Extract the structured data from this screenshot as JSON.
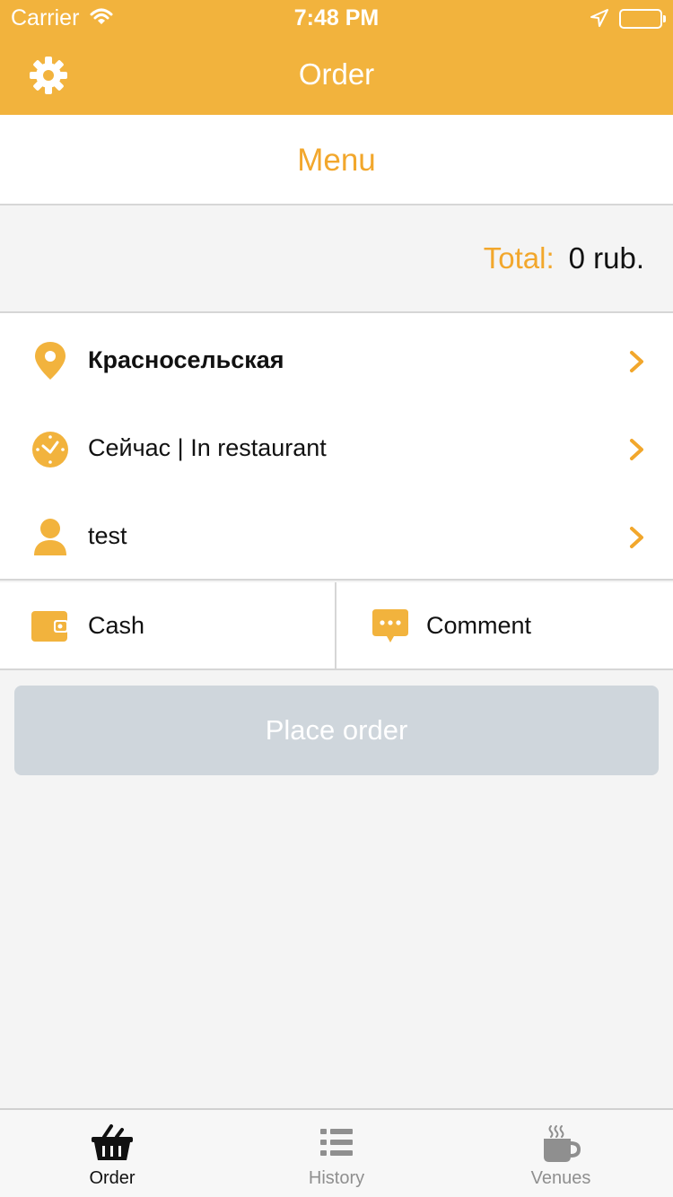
{
  "status_bar": {
    "carrier": "Carrier",
    "time": "7:48 PM",
    "icons": [
      "wifi-icon",
      "location-arrow-icon",
      "battery-icon"
    ]
  },
  "nav": {
    "title": "Order",
    "left_icon": "gear-icon"
  },
  "menu": {
    "label": "Menu"
  },
  "total": {
    "label": "Total:",
    "value": "0 rub."
  },
  "details": [
    {
      "icon": "location-pin-icon",
      "text": "Красносельская",
      "bold": true
    },
    {
      "icon": "clock-icon",
      "text": "Сейчас | In restaurant",
      "bold": false
    },
    {
      "icon": "user-icon",
      "text": "test",
      "bold": false
    }
  ],
  "payment": {
    "method_label": "Cash",
    "method_icon": "wallet-icon",
    "comment_label": "Comment",
    "comment_icon": "comment-bubble-icon"
  },
  "place_order": {
    "label": "Place order",
    "enabled": false
  },
  "tabs": [
    {
      "label": "Order",
      "icon": "basket-icon",
      "active": true
    },
    {
      "label": "History",
      "icon": "list-icon",
      "active": false
    },
    {
      "label": "Venues",
      "icon": "coffee-cup-icon",
      "active": false
    }
  ],
  "colors": {
    "accent": "#f2b33d",
    "accent_text": "#f2a72c",
    "disabled_button": "#cfd6dc",
    "background": "#f4f4f4",
    "tab_inactive": "#8f8f8f"
  }
}
